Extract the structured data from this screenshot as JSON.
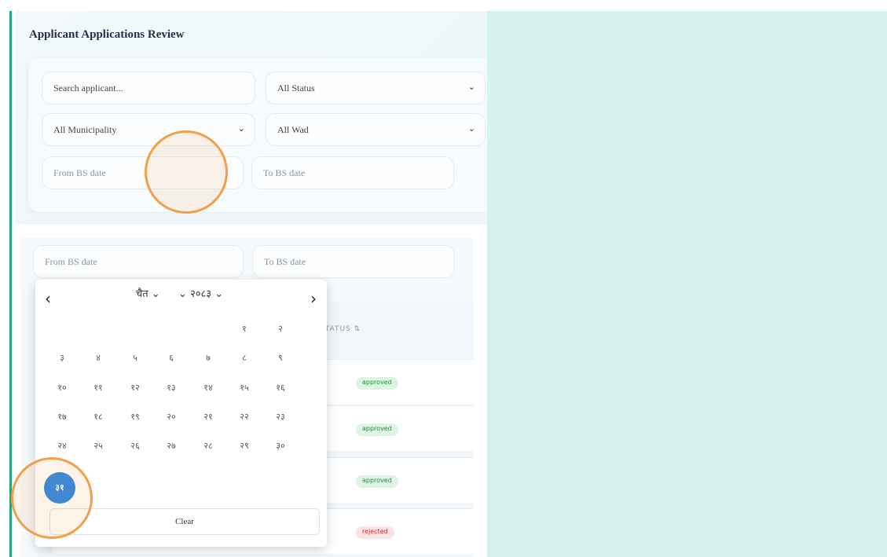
{
  "page": {
    "title": "Applicant Applications Review"
  },
  "filters": {
    "search_placeholder": "Search applicant...",
    "status_value": "All Status",
    "municipality_value": "All Municipality",
    "ward_value": "All Wad",
    "from_date_placeholder": "From BS date",
    "to_date_placeholder": "To BS date"
  },
  "table": {
    "status_header": "STATUS ⇅",
    "rows": [
      {
        "status": "approved",
        "status_color": "#1e8e3e"
      },
      {
        "status": "approved",
        "status_color": "#1e8e3e"
      },
      {
        "status": "approved",
        "status_color": "#1e8e3e"
      },
      {
        "status": "rejected",
        "status_color": "#c62828"
      }
    ]
  },
  "calendar": {
    "prev": "‹",
    "next": "›",
    "month": "चैत",
    "year": "२०८३",
    "days": [
      "१",
      "२",
      "३",
      "४",
      "५",
      "६",
      "७",
      "८",
      "९",
      "१०",
      "११",
      "१२",
      "१३",
      "१४",
      "१५",
      "१६",
      "१७",
      "१८",
      "१९",
      "२०",
      "२१",
      "२२",
      "२३",
      "२४",
      "२५",
      "२६",
      "२७",
      "२८",
      "२९",
      "३०",
      "३१"
    ],
    "selected_day": "३१",
    "clear_label": "Clear"
  },
  "colors": {
    "accent": "#1fa67a",
    "selected_day": "#2a86e5",
    "highlight": "#f0a04b"
  }
}
